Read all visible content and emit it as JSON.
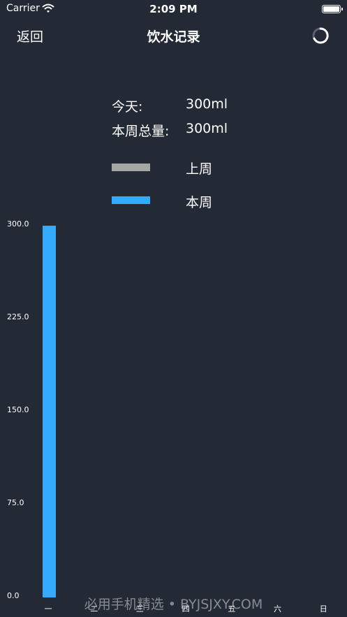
{
  "status_bar": {
    "carrier": "Carrier",
    "time": "2:09 PM"
  },
  "nav": {
    "back_label": "返回",
    "title": "饮水记录"
  },
  "stats": {
    "today_label": "今天:",
    "today_value": "300ml",
    "week_label": "本周总量:",
    "week_value": "300ml"
  },
  "legend": {
    "last_week": {
      "label": "上周",
      "color": "#a6a6a6"
    },
    "this_week": {
      "label": "本周",
      "color": "#34aaff"
    }
  },
  "chart_data": {
    "type": "bar",
    "categories": [
      "一",
      "二",
      "三",
      "四",
      "五",
      "六",
      "日"
    ],
    "series": [
      {
        "name": "本周",
        "color": "#34aaff",
        "values": [
          300,
          0,
          0,
          0,
          0,
          0,
          0
        ]
      }
    ],
    "yticks": [
      "0.0",
      "75.0",
      "150.0",
      "225.0",
      "300.0"
    ],
    "ylim": [
      0,
      300
    ],
    "grid": false
  },
  "watermark": "必用手机精选 • BYJSJXY.COM"
}
